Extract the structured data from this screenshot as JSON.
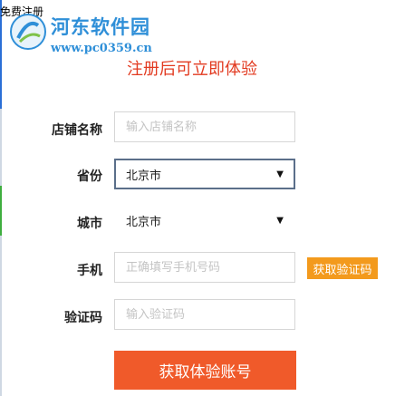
{
  "window": {
    "title": "免费注册"
  },
  "watermark": {
    "site_name": "河东软件园",
    "url": "www.pc0359.cn"
  },
  "form": {
    "headline": "注册后可立即体验",
    "store": {
      "label": "店铺名称",
      "placeholder": "输入店铺名称"
    },
    "province": {
      "label": "省份",
      "value": "北京市"
    },
    "city": {
      "label": "城市",
      "value": "北京市"
    },
    "phone": {
      "label": "手机",
      "placeholder": "正确填写手机号码"
    },
    "get_code_label": "获取验证码",
    "code": {
      "label": "验证码",
      "placeholder": "输入验证码"
    },
    "submit_label": "获取体验账号"
  },
  "colors": {
    "accent": "#f05a2a",
    "code_button": "#f39a1d",
    "headline": "#e23a20",
    "watermark": "#2f8fd8"
  },
  "icons": {
    "dropdown": "chevron-down-icon",
    "logo": "hedong-logo"
  }
}
